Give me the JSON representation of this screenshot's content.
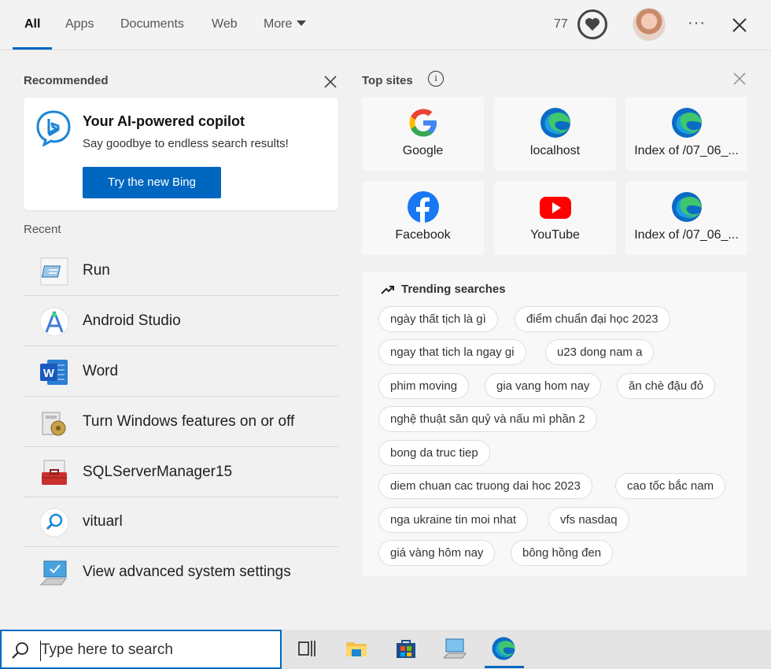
{
  "tabs": [
    {
      "label": "All",
      "active": true
    },
    {
      "label": "Apps"
    },
    {
      "label": "Documents"
    },
    {
      "label": "Web"
    },
    {
      "label": "More"
    }
  ],
  "header": {
    "points": "77",
    "more_icon": "ellipsis-icon",
    "close_icon": "close-icon"
  },
  "recommended": {
    "heading": "Recommended",
    "card": {
      "title": "Your AI-powered copilot",
      "subtitle": "Say goodbye to endless search results!",
      "button": "Try the new Bing"
    }
  },
  "recent": {
    "heading": "Recent",
    "items": [
      {
        "label": "Run",
        "icon": "run-icon"
      },
      {
        "label": "Android Studio",
        "icon": "android-studio-icon"
      },
      {
        "label": "Word",
        "icon": "word-icon"
      },
      {
        "label": "Turn Windows features on or off",
        "icon": "windows-features-icon"
      },
      {
        "label": "SQLServerManager15",
        "icon": "sql-server-icon"
      },
      {
        "label": "vituarl",
        "icon": "search-result-icon"
      },
      {
        "label": "View advanced system settings",
        "icon": "system-settings-icon"
      }
    ]
  },
  "top_sites": {
    "heading": "Top sites",
    "items": [
      {
        "label": "Google",
        "icon": "google-icon"
      },
      {
        "label": "localhost",
        "icon": "edge-icon"
      },
      {
        "label": "Index of /07_06_...",
        "icon": "edge-icon"
      },
      {
        "label": "Facebook",
        "icon": "facebook-icon"
      },
      {
        "label": "YouTube",
        "icon": "youtube-icon"
      },
      {
        "label": "Index of /07_06_...",
        "icon": "edge-icon"
      }
    ]
  },
  "trending": {
    "heading": "Trending searches",
    "chips": [
      "ngày thất tịch là gì",
      "điểm chuẩn đại học 2023",
      "ngay that tich la ngay gi",
      "u23 dong nam a",
      "phim moving",
      "gia vang hom nay",
      "ăn chè đậu đỏ",
      "nghệ thuật săn quỷ và nấu mì phần 2",
      "bong da truc tiep",
      "diem chuan cac truong dai hoc 2023",
      "cao tốc bắc nam",
      "nga ukraine tin moi nhat",
      "vfs nasdaq",
      "giá vàng hôm nay",
      "bông hồng đen"
    ]
  },
  "taskbar": {
    "search_placeholder": "Type here to search",
    "icons": [
      "task-view-icon",
      "file-explorer-icon",
      "store-icon",
      "this-pc-icon",
      "edge-icon"
    ]
  },
  "colors": {
    "accent": "#0067c0",
    "panel": "#f1f1f1"
  }
}
